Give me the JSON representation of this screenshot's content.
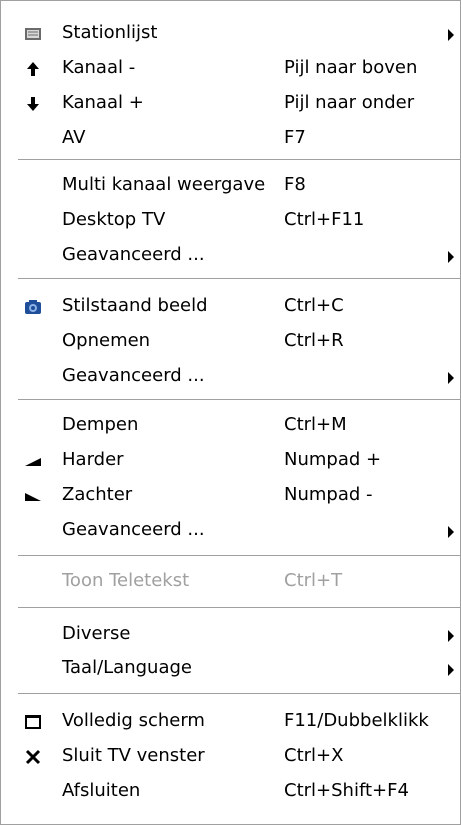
{
  "menu": {
    "items": [
      {
        "label": "Stationlijst",
        "shortcut": "",
        "submenu": true,
        "icon": "station-list-icon"
      },
      {
        "label": "Kanaal -",
        "shortcut": "Pijl naar boven",
        "submenu": false,
        "icon": "arrow-up-icon"
      },
      {
        "label": "Kanaal +",
        "shortcut": "Pijl naar onder",
        "submenu": false,
        "icon": "arrow-down-icon"
      },
      {
        "label": "AV",
        "shortcut": "F7",
        "submenu": false,
        "icon": ""
      },
      {
        "label": "Multi kanaal weergave",
        "shortcut": "F8",
        "submenu": false,
        "icon": ""
      },
      {
        "label": "Desktop TV",
        "shortcut": "Ctrl+F11",
        "submenu": false,
        "icon": ""
      },
      {
        "label": "Geavanceerd ...",
        "shortcut": "",
        "submenu": true,
        "icon": ""
      },
      {
        "label": "Stilstaand beeld",
        "shortcut": "Ctrl+C",
        "submenu": false,
        "icon": "camera-icon"
      },
      {
        "label": "Opnemen",
        "shortcut": "Ctrl+R",
        "submenu": false,
        "icon": ""
      },
      {
        "label": "Geavanceerd ...",
        "shortcut": "",
        "submenu": true,
        "icon": ""
      },
      {
        "label": "Dempen",
        "shortcut": "Ctrl+M",
        "submenu": false,
        "icon": ""
      },
      {
        "label": "Harder",
        "shortcut": "Numpad +",
        "submenu": false,
        "icon": "volume-up-icon"
      },
      {
        "label": "Zachter",
        "shortcut": "Numpad -",
        "submenu": false,
        "icon": "volume-down-icon"
      },
      {
        "label": "Geavanceerd ...",
        "shortcut": "",
        "submenu": true,
        "icon": ""
      },
      {
        "label": "Toon Teletekst",
        "shortcut": "Ctrl+T",
        "submenu": false,
        "icon": "",
        "disabled": true
      },
      {
        "label": "Diverse",
        "shortcut": "",
        "submenu": true,
        "icon": ""
      },
      {
        "label": "Taal/Language",
        "shortcut": "",
        "submenu": true,
        "icon": ""
      },
      {
        "label": "Volledig scherm",
        "shortcut": "F11/Dubbelklikk",
        "submenu": false,
        "icon": "fullscreen-icon"
      },
      {
        "label": "Sluit TV venster",
        "shortcut": "Ctrl+X",
        "submenu": false,
        "icon": "close-icon"
      },
      {
        "label": "Afsluiten",
        "shortcut": "Ctrl+Shift+F4",
        "submenu": false,
        "icon": ""
      }
    ]
  },
  "colors": {
    "text": "#000000",
    "disabled_text": "#a0a0a0",
    "separator": "#a0a0a0",
    "background": "#ffffff",
    "camera_icon": "#1f4e9a"
  }
}
